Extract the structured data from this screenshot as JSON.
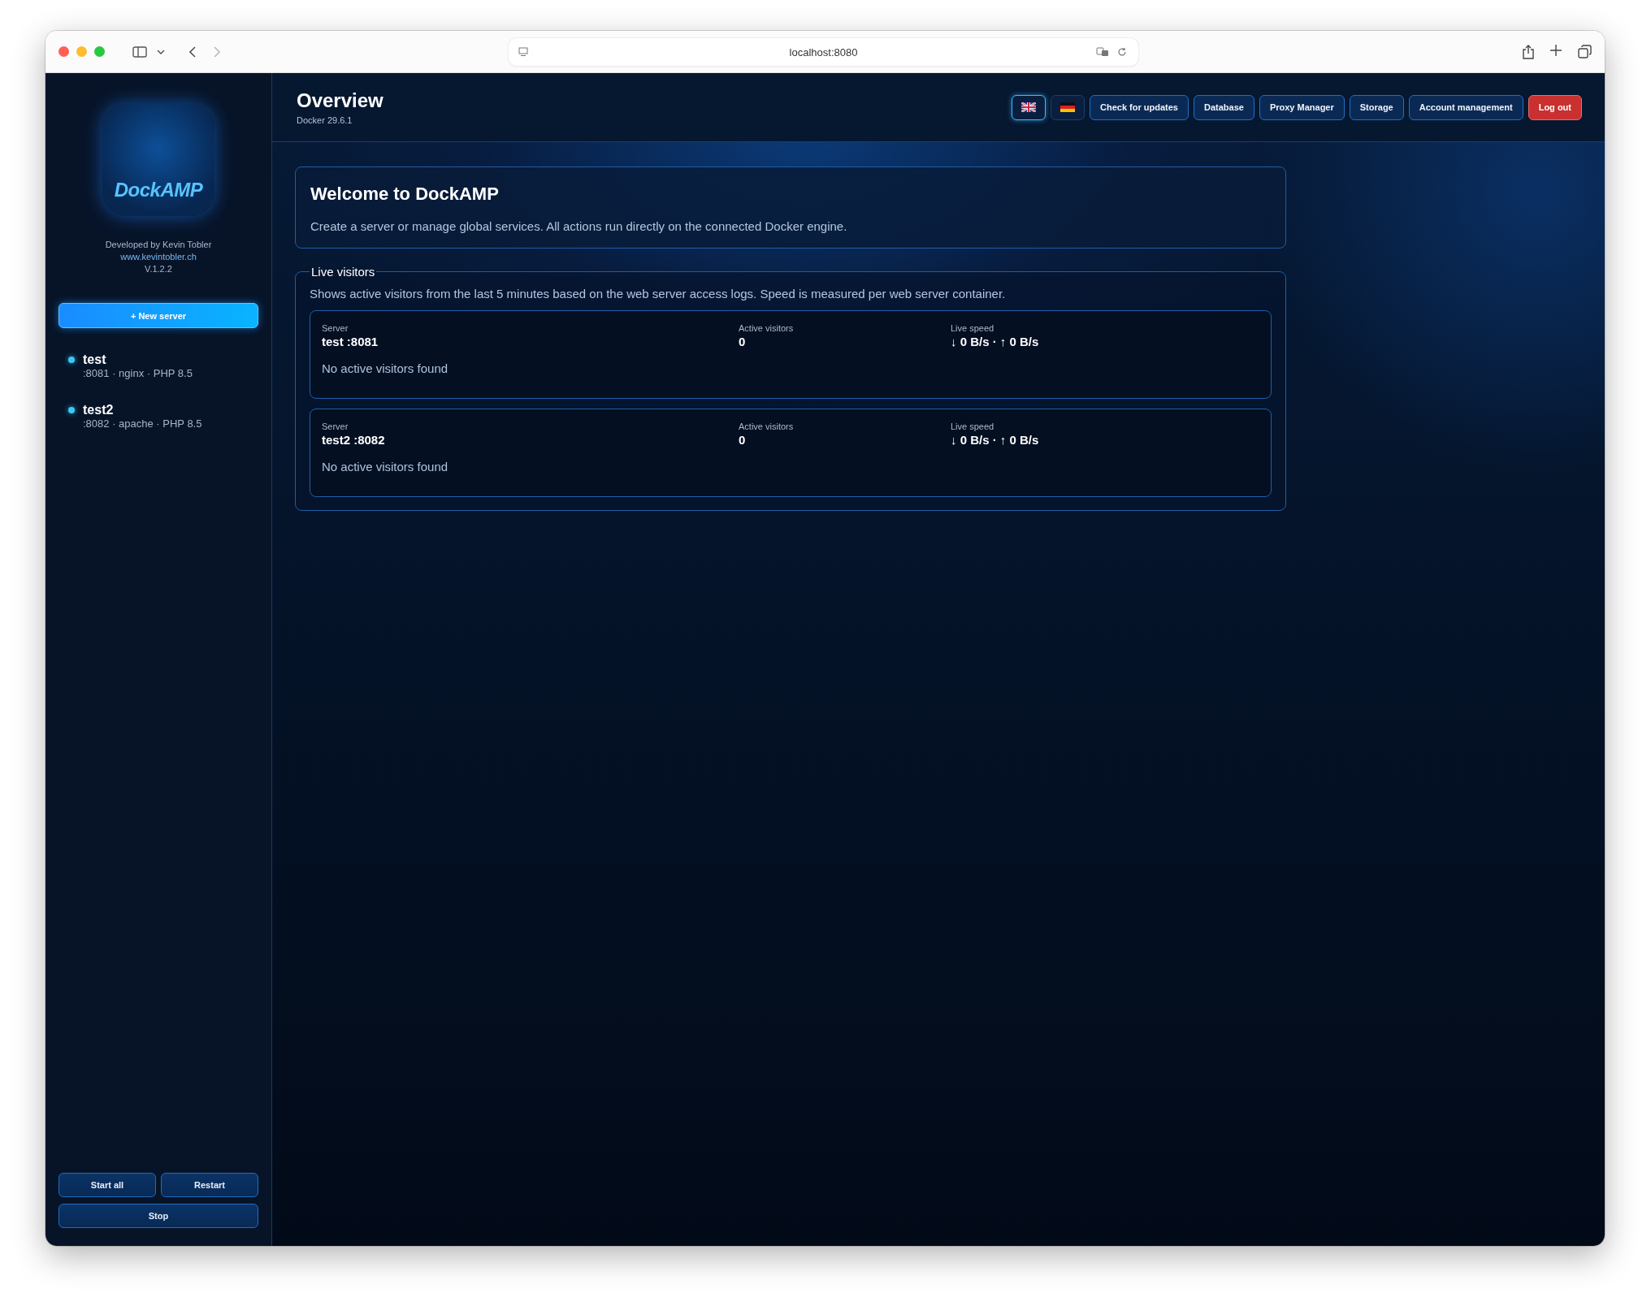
{
  "browser": {
    "url": "localhost:8080"
  },
  "sidebar": {
    "logo_text": "DockAMP",
    "credits": "Developed by Kevin Tobler",
    "website": "www.kevintobler.ch",
    "version": "V.1.2.2",
    "new_button": "+ New server",
    "servers": [
      {
        "name": "test",
        "details": ":8081 · nginx · PHP 8.5",
        "color": "#3cc8f5"
      },
      {
        "name": "test2",
        "details": ":8082 · apache · PHP 8.5",
        "color": "#3cc8f5"
      }
    ],
    "bottom_buttons": [
      "Start all",
      "Restart",
      "Stop"
    ]
  },
  "header": {
    "title": "Overview",
    "subtitle": "Docker 29.6.1",
    "languages": [
      {
        "kind": "uk",
        "selected": true
      },
      {
        "kind": "de",
        "selected": false
      }
    ],
    "buttons": [
      {
        "label": "Check for updates",
        "kind": "normal"
      },
      {
        "label": "Database",
        "kind": "normal"
      },
      {
        "label": "Proxy Manager",
        "kind": "normal"
      },
      {
        "label": "Storage",
        "kind": "normal"
      },
      {
        "label": "Account management",
        "kind": "normal"
      },
      {
        "label": "Log out",
        "kind": "danger"
      }
    ]
  },
  "welcome": {
    "title": "Welcome to DockAMP",
    "text": "Create a server or manage global services. All actions run directly on the connected Docker engine."
  },
  "live_visitors": {
    "legend": "Live visitors",
    "description": "Shows active visitors from the last 5 minutes based on the web server access logs. Speed is measured per web server container.",
    "servers": [
      {
        "server_label": "Server",
        "server": "test :8081",
        "visitors_label": "Active visitors",
        "visitors": "0",
        "speed_label": "Live speed",
        "speed": "↓ 0 B/s · ↑ 0 B/s",
        "empty": "No active visitors found"
      },
      {
        "server_label": "Server",
        "server": "test2 :8082",
        "visitors_label": "Active visitors",
        "visitors": "0",
        "speed_label": "Live speed",
        "speed": "↓ 0 B/s · ↑ 0 B/s",
        "empty": "No active visitors found"
      }
    ]
  }
}
